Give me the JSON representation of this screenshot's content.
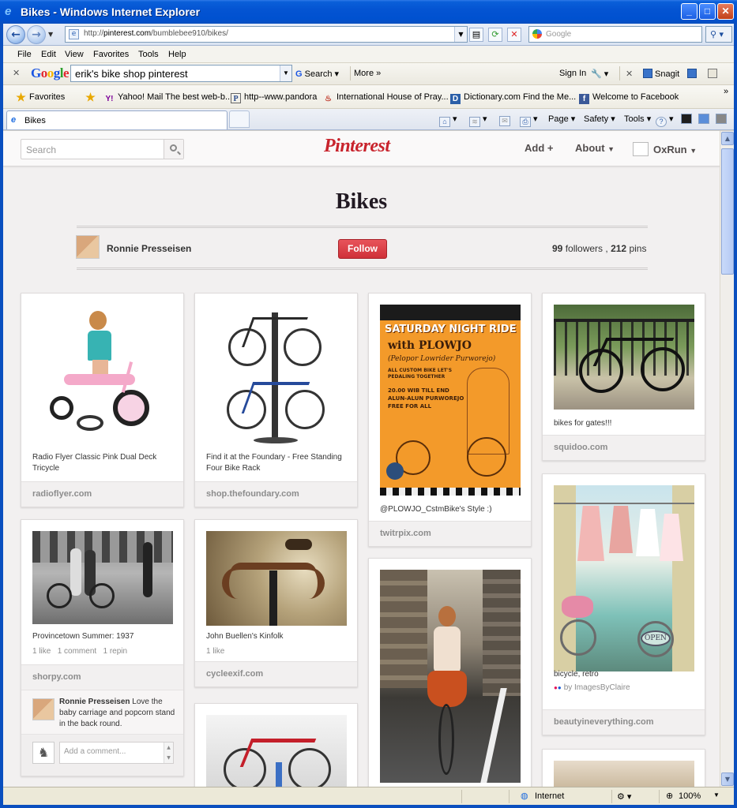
{
  "window": {
    "title": "Bikes - Windows Internet Explorer",
    "address": {
      "prefix": "http://",
      "host": "pinterest.com",
      "path": "/bumblebee910/bikes/"
    },
    "search_placeholder": "Google",
    "menu": [
      "File",
      "Edit",
      "View",
      "Favorites",
      "Tools",
      "Help"
    ],
    "google_toolbar": {
      "logo": [
        "G",
        "o",
        "o",
        "g",
        "l",
        "e"
      ],
      "query": "erik's bike shop pinterest",
      "search_label": "Search",
      "more_label": "More »",
      "sign_in": "Sign In",
      "snagit": "Snagit"
    },
    "favorites": {
      "label": "Favorites",
      "items": [
        "Yahoo! Mail The best web-b...",
        "http--www.pandora",
        "International House of Pray...",
        "Dictionary.com  Find the Me...",
        "Welcome to Facebook"
      ]
    },
    "tab_label": "Bikes",
    "commands": {
      "page": "Page",
      "safety": "Safety",
      "tools": "Tools"
    },
    "status": {
      "zone": "Internet",
      "zoom": "100%"
    }
  },
  "pinterest": {
    "search_placeholder": "Search",
    "logo": "Pinterest",
    "nav": {
      "add": "Add +",
      "about": "About",
      "user": "OxRun"
    },
    "board_title": "Bikes",
    "owner": "Ronnie Presseisen",
    "follow_label": "Follow",
    "followers_count": "99",
    "followers_label": "followers ,",
    "pins_count": "212",
    "pins_label": "pins",
    "pins": [
      {
        "desc": "Radio Flyer Classic Pink Dual Deck Tricycle",
        "source": "radioflyer.com"
      },
      {
        "desc": "Find it at the Foundary - Free Standing Four Bike Rack",
        "source": "shop.thefoundary.com"
      },
      {
        "desc": "@PLOWJO_CstmBike's Style :)",
        "source": "twitrpix.com",
        "poster": {
          "line1": "SATURDAY NIGHT RIDE",
          "line2": "with PLOWJO",
          "line3": "(Pelopor Lowrider Purworejo)",
          "line4": "ALL CUSTOM BIKE LET'S PEDALING TOGETHER",
          "line5": "20.00 WIB TILL END ALUN-ALUN PURWOREJO FREE FOR ALL"
        }
      },
      {
        "desc": "bikes for gates!!!",
        "source": "squidoo.com"
      },
      {
        "desc": "Provincetown Summer: 1937",
        "likes": "1 like",
        "comments": "1 comment",
        "repins": "1 repin",
        "source": "shorpy.com",
        "comment_author": "Ronnie Presseisen",
        "comment_text": "Love the baby carriage and popcorn stand in the back round.",
        "comment_placeholder": "Add a comment..."
      },
      {
        "desc": "John Buellen's Kinfolk",
        "likes": "1 like",
        "source": "cycleexif.com"
      },
      {
        "desc": "bicycle, retro",
        "via": "by ImagesByClaire",
        "source": "beautyineverything.com",
        "sign": "OPEN"
      }
    ]
  }
}
